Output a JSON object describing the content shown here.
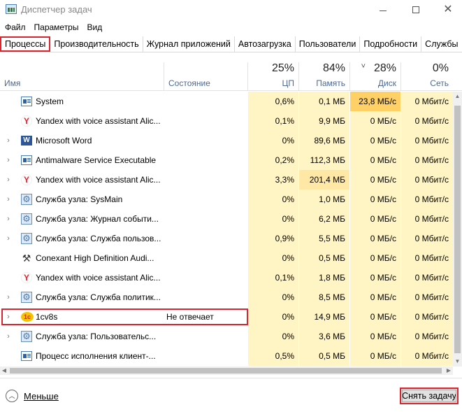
{
  "window": {
    "title": "Диспетчер задач",
    "icon": "task-manager-icon"
  },
  "menu": [
    "Файл",
    "Параметры",
    "Вид"
  ],
  "tabs": [
    {
      "label": "Процессы",
      "active": true
    },
    {
      "label": "Производительность"
    },
    {
      "label": "Журнал приложений"
    },
    {
      "label": "Автозагрузка"
    },
    {
      "label": "Пользователи"
    },
    {
      "label": "Подробности"
    },
    {
      "label": "Службы"
    }
  ],
  "columns": {
    "name": "Имя",
    "status": "Состояние",
    "cpu": {
      "label": "ЦП",
      "total": "25%"
    },
    "memory": {
      "label": "Память",
      "total": "84%"
    },
    "disk": {
      "label": "Диск",
      "total": "28%",
      "sorted": true
    },
    "network": {
      "label": "Сеть",
      "total": "0%"
    }
  },
  "rows": [
    {
      "expand": false,
      "icon": "system-icon",
      "name": "System",
      "status": "",
      "cpu": "0,6%",
      "mem": "0,1 МБ",
      "disk": "23,8 МБ/с",
      "net": "0 Мбит/с",
      "disk_hi": "strong"
    },
    {
      "expand": false,
      "icon": "yandex-icon",
      "name": "Yandex with voice assistant Alic...",
      "status": "",
      "cpu": "0,1%",
      "mem": "9,9 МБ",
      "disk": "0 МБ/с",
      "net": "0 Мбит/с"
    },
    {
      "expand": true,
      "icon": "word-icon",
      "name": "Microsoft Word",
      "status": "",
      "cpu": "0%",
      "mem": "89,6 МБ",
      "disk": "0 МБ/с",
      "net": "0 Мбит/с"
    },
    {
      "expand": true,
      "icon": "system-icon",
      "name": "Antimalware Service Executable",
      "status": "",
      "cpu": "0,2%",
      "mem": "112,3 МБ",
      "disk": "0 МБ/с",
      "net": "0 Мбит/с"
    },
    {
      "expand": true,
      "icon": "yandex-icon",
      "name": "Yandex with voice assistant Alic...",
      "status": "",
      "cpu": "3,3%",
      "mem": "201,4 МБ",
      "disk": "0 МБ/с",
      "net": "0 Мбит/с",
      "mem_hi": "mid"
    },
    {
      "expand": true,
      "icon": "gear-icon",
      "name": "Служба узла: SysMain",
      "status": "",
      "cpu": "0%",
      "mem": "1,0 МБ",
      "disk": "0 МБ/с",
      "net": "0 Мбит/с"
    },
    {
      "expand": true,
      "icon": "gear-icon",
      "name": "Служба узла: Журнал событи...",
      "status": "",
      "cpu": "0%",
      "mem": "6,2 МБ",
      "disk": "0 МБ/с",
      "net": "0 Мбит/с"
    },
    {
      "expand": true,
      "icon": "gear-icon",
      "name": "Служба узла: Служба пользов...",
      "status": "",
      "cpu": "0,9%",
      "mem": "5,5 МБ",
      "disk": "0 МБ/с",
      "net": "0 Мбит/с"
    },
    {
      "expand": false,
      "icon": "tools-icon",
      "name": "Conexant High Definition Audi...",
      "status": "",
      "cpu": "0%",
      "mem": "0,5 МБ",
      "disk": "0 МБ/с",
      "net": "0 Мбит/с"
    },
    {
      "expand": false,
      "icon": "yandex-icon",
      "name": "Yandex with voice assistant Alic...",
      "status": "",
      "cpu": "0,1%",
      "mem": "1,8 МБ",
      "disk": "0 МБ/с",
      "net": "0 Мбит/с"
    },
    {
      "expand": true,
      "icon": "gear-icon",
      "name": "Служба узла: Служба политик...",
      "status": "",
      "cpu": "0%",
      "mem": "8,5 МБ",
      "disk": "0 МБ/с",
      "net": "0 Мбит/с"
    },
    {
      "expand": true,
      "icon": "1c-icon",
      "name": "1cv8s",
      "status": "Не отвечает",
      "cpu": "0%",
      "mem": "14,9 МБ",
      "disk": "0 МБ/с",
      "net": "0 Мбит/с"
    },
    {
      "expand": true,
      "icon": "gear-icon",
      "name": "Служба узла: Пользовательс...",
      "status": "",
      "cpu": "0%",
      "mem": "3,6 МБ",
      "disk": "0 МБ/с",
      "net": "0 Мбит/с"
    },
    {
      "expand": false,
      "icon": "system-icon",
      "name": "Процесс исполнения клиент-...",
      "status": "",
      "cpu": "0,5%",
      "mem": "0,5 МБ",
      "disk": "0 МБ/с",
      "net": "0 Мбит/с"
    }
  ],
  "footer": {
    "fewer_label": "Меньше",
    "end_task_label": "Снять задачу"
  },
  "colors": {
    "highlight_red": "#d9252f",
    "cell_light": "#fff4c4",
    "cell_mid": "#ffe8a6",
    "cell_strong": "#ffd066"
  }
}
